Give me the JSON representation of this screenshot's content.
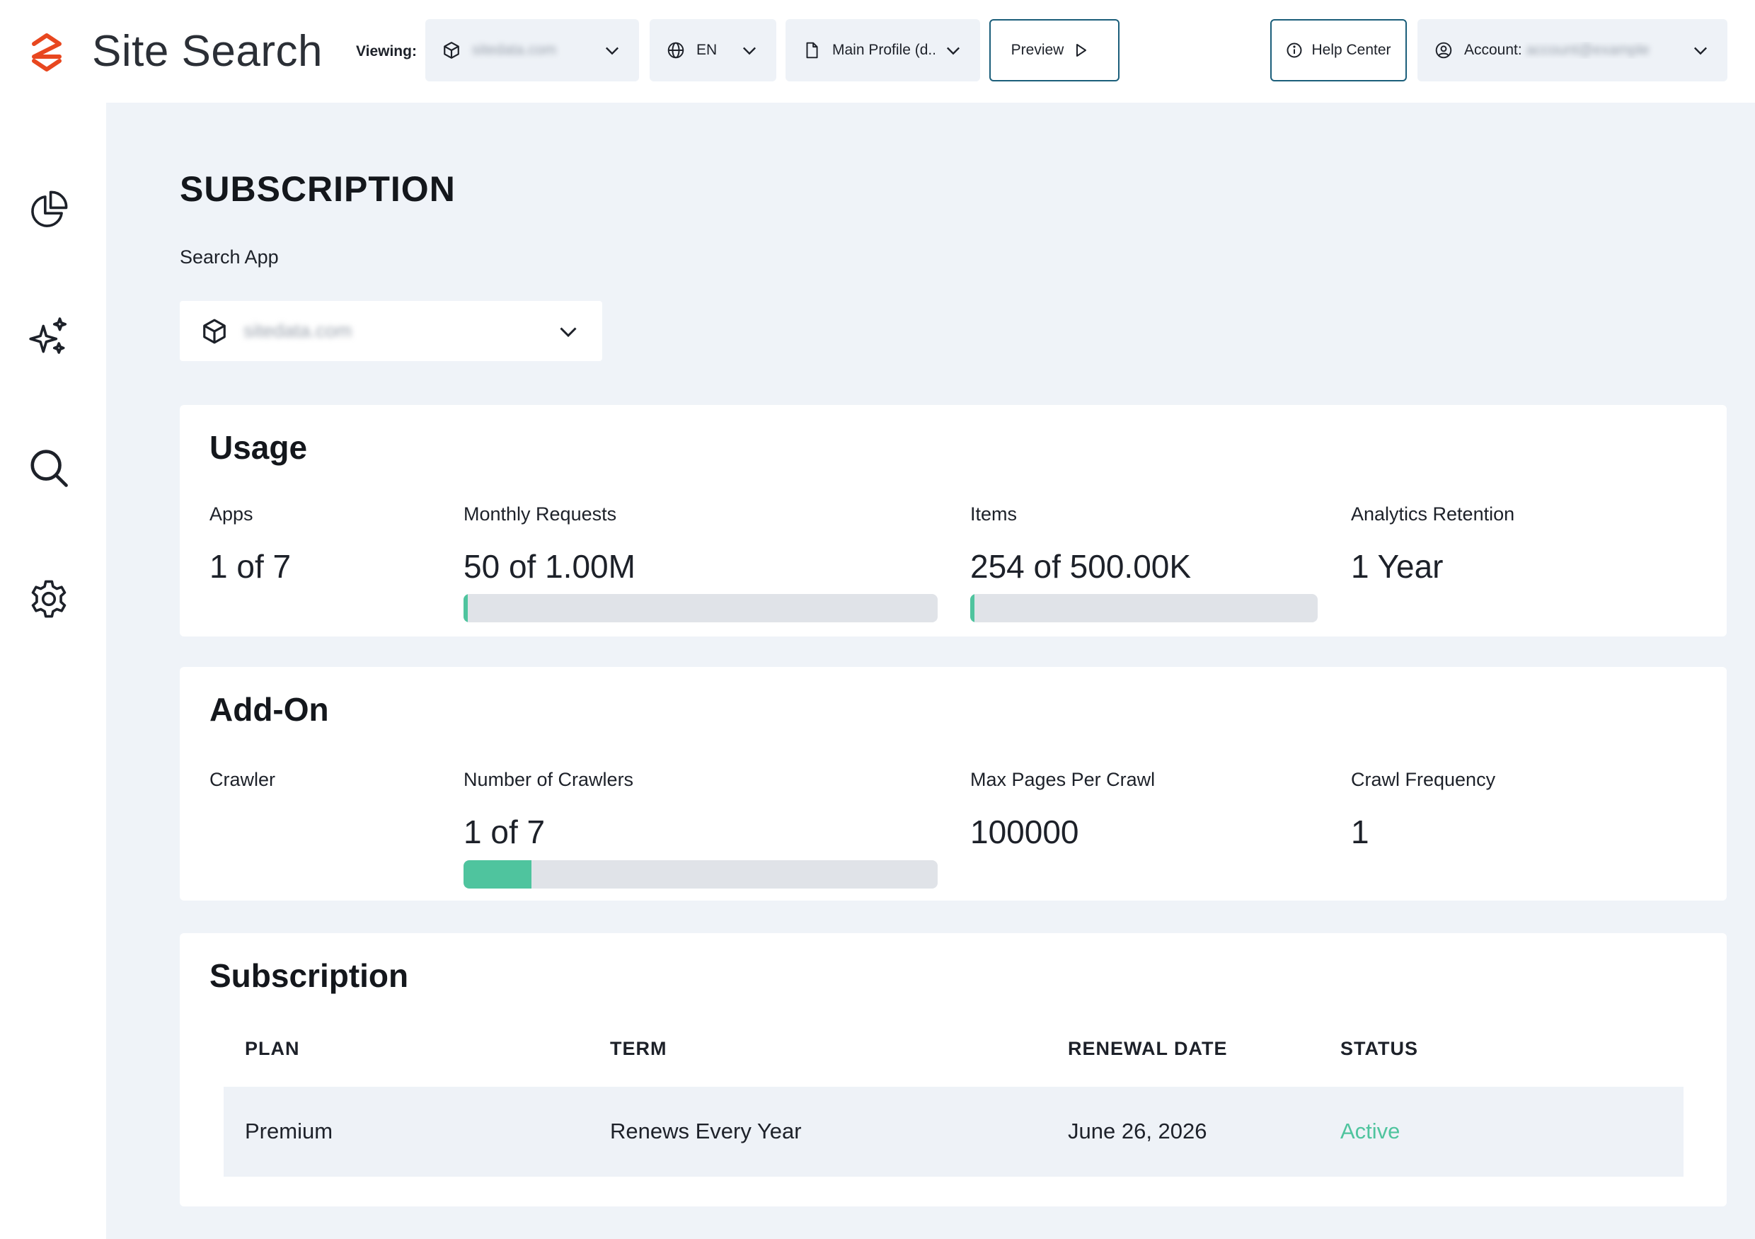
{
  "header": {
    "brand": "Site Search",
    "viewing_label": "Viewing:",
    "app_selector_value": "sitedata.com",
    "language_value": "EN",
    "profile_value": "Main Profile (d...",
    "preview_label": "Preview",
    "help_label": "Help Center",
    "account_label": "Account:",
    "account_value": "account@example"
  },
  "icons": {
    "logo": "site-search-logo",
    "app": "cube-icon",
    "language": "globe-icon",
    "profile": "document-icon",
    "preview": "play-icon",
    "help": "info-circle-icon",
    "account": "user-circle-icon",
    "sidebar": [
      "pie-chart-icon",
      "sparkles-icon",
      "search-icon",
      "gear-icon"
    ]
  },
  "colors": {
    "brand": "#e8471f",
    "accent_border": "#1b5e7a",
    "progress_fill": "#4fc49e",
    "status_active": "#4fc49e",
    "page_background": "#eff3f8"
  },
  "page": {
    "title": "SUBSCRIPTION",
    "search_app_label": "Search App",
    "search_app_value": "sitedata.com"
  },
  "usage": {
    "title": "Usage",
    "metrics": [
      {
        "label": "Apps",
        "value": "1 of 7"
      },
      {
        "label": "Monthly Requests",
        "value": "50 of 1.00M",
        "progress": 5e-05
      },
      {
        "label": "Items",
        "value": "254 of 500.00K",
        "progress": 0.0005
      },
      {
        "label": "Analytics Retention",
        "value": "1 Year"
      }
    ]
  },
  "addon": {
    "title": "Add-On",
    "metrics": [
      {
        "label": "Crawler",
        "value": ""
      },
      {
        "label": "Number of Crawlers",
        "value": "1 of 7",
        "progress": 0.1429
      },
      {
        "label": "Max Pages Per Crawl",
        "value": "100000"
      },
      {
        "label": "Crawl Frequency",
        "value": "1"
      }
    ]
  },
  "subscription": {
    "title": "Subscription",
    "columns": [
      "PLAN",
      "TERM",
      "RENEWAL DATE",
      "STATUS"
    ],
    "rows": [
      {
        "plan": "Premium",
        "term": "Renews Every Year",
        "renewal_date": "June 26, 2026",
        "status": "Active"
      }
    ]
  }
}
